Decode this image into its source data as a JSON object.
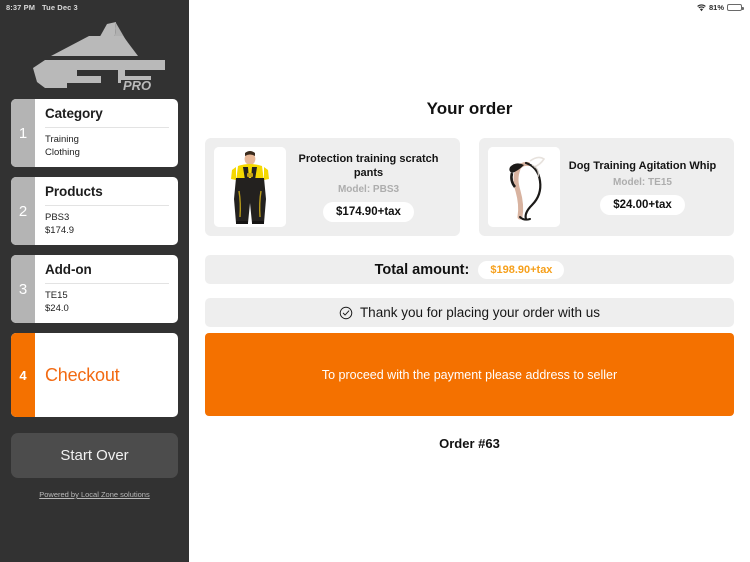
{
  "status_bar": {
    "time": "8:37 PM",
    "date": "Tue Dec 3",
    "battery_percent": "81%",
    "wifi_icon": "wifi-icon",
    "battery_icon": "battery-icon"
  },
  "sidebar": {
    "logo_alt": "FDT PRO",
    "steps": [
      {
        "number": "1",
        "title": "Category",
        "lines": [
          "Training",
          "Clothing"
        ],
        "active": false
      },
      {
        "number": "2",
        "title": "Products",
        "lines": [
          "PBS3",
          "$174.9"
        ],
        "active": false
      },
      {
        "number": "3",
        "title": "Add-on",
        "lines": [
          "TE15",
          "$24.0"
        ],
        "active": false
      },
      {
        "number": "4",
        "title": "Checkout",
        "lines": [],
        "active": true
      }
    ],
    "start_over_label": "Start Over",
    "powered_by": "Powered by Local Zone solutions"
  },
  "main": {
    "page_title": "Your order",
    "items": [
      {
        "name": "Protection training scratch pants",
        "model_label": "Model: PBS3",
        "price": "$174.90+tax",
        "image": "protection-training-scratch-pants-photo"
      },
      {
        "name": "Dog Training Agitation Whip",
        "model_label": "Model: TE15",
        "price": "$24.00+tax",
        "image": "dog-training-agitation-whip-photo"
      }
    ],
    "total_label": "Total amount:",
    "total_value": "$198.90+tax",
    "thanks_icon": "check-circle-icon",
    "thanks_text": "Thank you for placing your order with us",
    "notice_text": "To proceed with the payment please address to seller",
    "order_number": "Order #63"
  },
  "colors": {
    "accent_orange": "#f47100",
    "checkout_text": "#f26a12",
    "total_value": "#f6a01c",
    "sidebar_bg": "#323232",
    "card_bg": "#eeeeee",
    "step_number_bg": "#b4b4b4",
    "battery_green": "#3fce5b"
  }
}
